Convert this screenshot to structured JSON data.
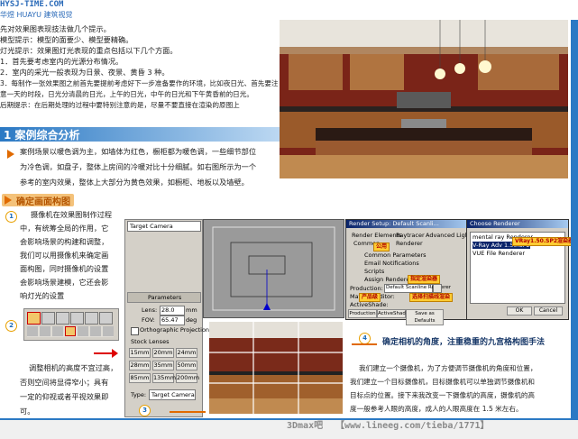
{
  "brand": {
    "site": "HYSJ-TIME.COM",
    "name": "华煜 HUAYU 建筑视觉"
  },
  "intro_lines": [
    "先对效果图表现技法做几个提示。",
    "模型提示：模型的面要少、模型要精确。",
    "灯光提示：效果图灯光表现的重点包括以下几个方面。",
    "1．首先要考虑室内的光源分布情况。",
    "2．室内的采光一般表现为日景、夜景、黄昏 3 种。",
    "3．每制作一张效果图之前首先要提前考虑好下一步准备要作的环境，比如夜日光、首先要注",
    "意一天的时段，日光分清晨的日光，上午的日光，中午的日光和下午黄昏前的日光。",
    "后期提示：在后期处理的过程中要特别注意的是，尽量不要直接在渲染的原图上"
  ],
  "section": {
    "title": "1 案例综合分析"
  },
  "case_lines": [
    "案例场景以暖色调为主，如墙体为红色，橱柜都为暖色调，一些细节部位",
    "为冷色调，如盘子，整体上房间的冷暖对比十分细腻。如右图所示为一个",
    "参考的室内效果，整体上大部分为黄色效果，如橱柜、地板以及墙壁。"
  ],
  "subsection": {
    "title": "确定画面构图"
  },
  "step1_lines": [
    "摄像机在效果图制作过程",
    "中，有统筹全局的作用，它",
    "会影响场景的构建和调整，",
    "我们可以用摄像机来确定画",
    "面构图，同时摄像机的设置",
    "会影响场景建模，它还会影",
    "响灯光的设置"
  ],
  "step2_lines": [
    "调整相机的高度不宜过高，",
    "否则空间将显得窄小；具有",
    "一定的仰视或者平视效果即",
    "可。"
  ],
  "step_numbers": [
    "1",
    "2",
    "3",
    "4"
  ],
  "step4_caption": "确定相机的角度，注重稳重的九宫格构图手法",
  "closing_lines": [
    "我们建立一个摄像机，为了方便调节摄像机的角度和位置，",
    "我们建立一个目标摄像机，目标摄像机可以单独调节摄像机和",
    "目标点的位置。接下来我改变一下摄像机的高度，摄像机的高",
    "度一般参考人眼的高度，成人的人眼高度在 1.5 米左右。"
  ],
  "camera_panel": {
    "object_name": "Target Camera",
    "rollout": "Parameters",
    "lens_label": "Lens:",
    "lens_value": "28.0",
    "lens_unit": "mm",
    "fov_label": "FOV:",
    "fov_value": "65.47",
    "fov_unit": "deg",
    "ortho_label": "Orthographic Projection",
    "stock_label": "Stock Lenses",
    "stock_lenses": [
      "15mm",
      "20mm",
      "24mm",
      "28mm",
      "35mm",
      "50mm",
      "85mm",
      "135mm",
      "200mm"
    ],
    "type_label": "Type:",
    "type_value": "Target Camera"
  },
  "render_dialog": {
    "title": "Render Setup: Default Scanli...",
    "tabs": [
      "Render Elements",
      "Raytracer",
      "Advanced Lighting",
      "Common",
      "Renderer"
    ],
    "rows": [
      "Common Parameters",
      "Email Notifications",
      "Scripts",
      "Assign Renderer",
      "Production:",
      "Material Editor:",
      "ActiveShade:",
      "Default Scanline Renderer"
    ],
    "buttons": [
      "Production",
      "ActiveShade",
      "Save as Defaults"
    ],
    "callouts": [
      "公用",
      "指定渲染器",
      "产品级",
      "选择扫描线渲染"
    ]
  },
  "choose_renderer": {
    "title": "Choose Renderer",
    "items": [
      "mental ray Renderer",
      "V-Ray Adv 1.50.SP2",
      "VUE File Renderer"
    ],
    "callout": "VRay1.50.SP2渲染器",
    "ok": "OK",
    "cancel": "Cancel"
  },
  "footer": {
    "left": "3Dmax吧",
    "url": "【www.lineeg.com/tieba/1771】"
  },
  "colors": {
    "accent_blue": "#2b79c4",
    "accent_orange": "#e06a00",
    "callout_yellow": "#ffcc33"
  }
}
